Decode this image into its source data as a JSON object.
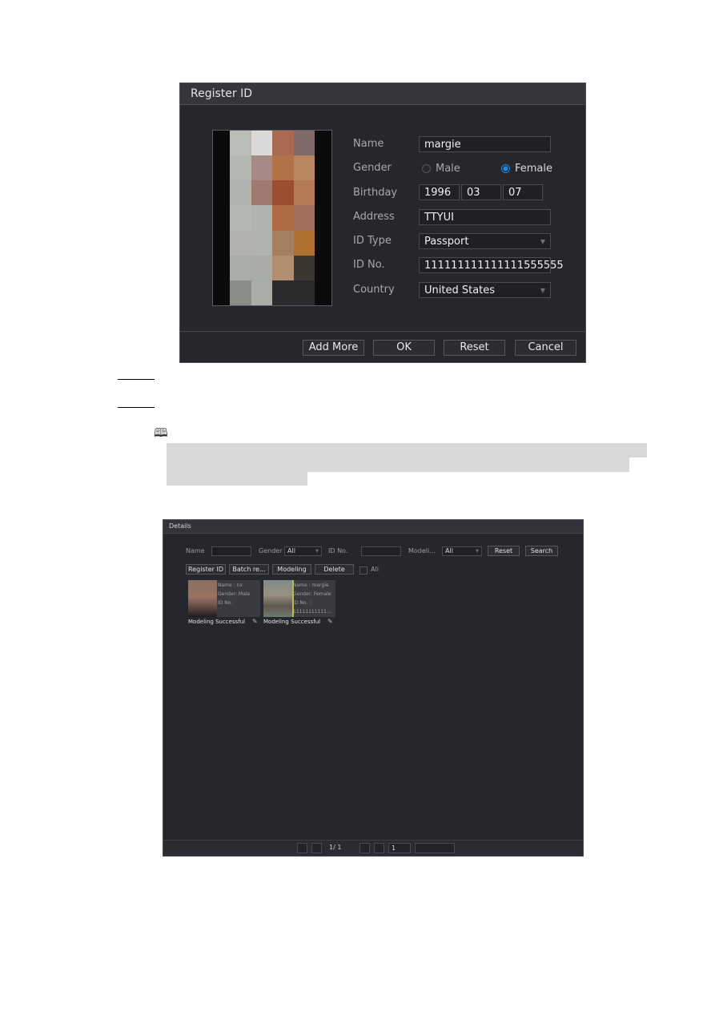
{
  "register_dialog": {
    "title": "Register ID",
    "photo": "person-face-photo-pixelated",
    "fields": {
      "name_label": "Name",
      "name_value": "margie",
      "gender_label": "Gender",
      "gender_options": [
        "Male",
        "Female"
      ],
      "gender_selected": "Female",
      "birthday_label": "Birthday",
      "birthday_year": "1996",
      "birthday_month": "03",
      "birthday_day": "07",
      "address_label": "Address",
      "address_value": "TTYUI",
      "id_type_label": "ID Type",
      "id_type_value": "Passport",
      "id_no_label": "ID No.",
      "id_no_value": "111111111111111555555",
      "country_label": "Country",
      "country_value": "United States"
    },
    "buttons": {
      "add_more": "Add More",
      "ok": "OK",
      "reset": "Reset",
      "cancel": "Cancel"
    },
    "accent_color": "#1e88e5"
  },
  "note": {
    "icon": "book-note-icon"
  },
  "details_dialog": {
    "title": "Details",
    "filters": {
      "name_label": "Name",
      "name_value": "",
      "gender_label": "Gender",
      "gender_value": "All",
      "id_no_label": "ID No.",
      "id_no_value": "",
      "modeling_label": "Modeli...",
      "modeling_value": "All",
      "reset": "Reset",
      "search": "Search"
    },
    "actions": {
      "register_id": "Register ID",
      "batch": "Batch re...",
      "modeling": "Modeling",
      "delete": "Delete",
      "all_label": "All"
    },
    "cards": [
      {
        "name": "Name : nx",
        "gender": "Gender: Male",
        "id_no": "ID No.",
        "id_value": "",
        "status": "Modeling Successful"
      },
      {
        "name": "Name : margie",
        "gender": "Gender: Female",
        "id_no": "ID No. :",
        "id_value": "11111111111...",
        "status": "Modeling Successful"
      }
    ],
    "pager": {
      "page_text": "1/ 1",
      "goto_value": "1"
    }
  }
}
